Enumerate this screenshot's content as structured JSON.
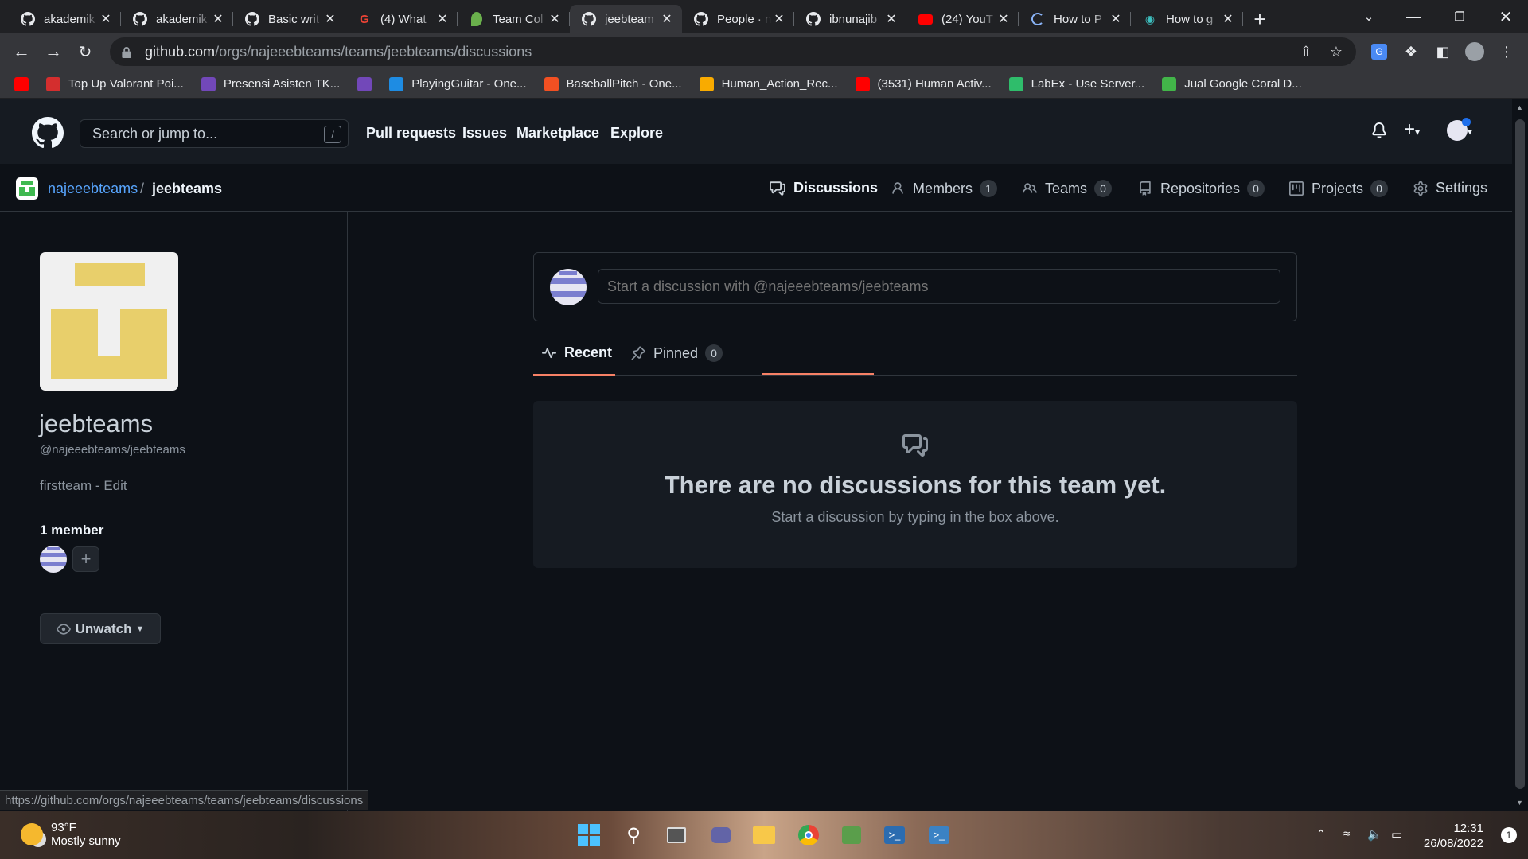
{
  "browser": {
    "tabs": [
      {
        "title": "akademik",
        "icon": "github-icon",
        "active": false
      },
      {
        "title": "akademik",
        "icon": "github-icon",
        "active": false
      },
      {
        "title": "Basic writ",
        "icon": "github-icon",
        "active": false
      },
      {
        "title": "(4) What",
        "icon": "google-icon",
        "active": false
      },
      {
        "title": "Team Col",
        "icon": "leaf-icon",
        "active": false
      },
      {
        "title": "jeebteam",
        "icon": "github-icon",
        "active": true
      },
      {
        "title": "People · n",
        "icon": "github-icon",
        "active": false
      },
      {
        "title": "ibnunajib",
        "icon": "github-icon",
        "active": false
      },
      {
        "title": "(24) YouT",
        "icon": "youtube-icon",
        "active": false
      },
      {
        "title": "How to P",
        "icon": "loading-icon",
        "active": false
      },
      {
        "title": "How to g",
        "icon": "eye-icon",
        "active": false
      }
    ],
    "url_host": "github.com",
    "url_path": "/orgs/najeeebteams/teams/jeebteams/discussions",
    "bookmarks": [
      {
        "label": "",
        "icon": "youtube-icon",
        "color": "#ff0000"
      },
      {
        "label": "Top Up Valorant Poi...",
        "icon": "codashop-icon",
        "color": "#d42e2e"
      },
      {
        "label": "Presensi Asisten TK...",
        "icon": "forms-icon",
        "color": "#7248b9"
      },
      {
        "label": "",
        "icon": "forms-icon",
        "color": "#7248b9"
      },
      {
        "label": "PlayingGuitar - One...",
        "icon": "onedrive-icon",
        "color": "#1e8ce3"
      },
      {
        "label": "BaseballPitch - One...",
        "icon": "windows-icon",
        "color": "#f25022"
      },
      {
        "label": "Human_Action_Rec...",
        "icon": "colab-icon",
        "color": "#f9ab00"
      },
      {
        "label": "(3531) Human Activ...",
        "icon": "youtube-icon",
        "color": "#ff0000"
      },
      {
        "label": "LabEx - Use Server...",
        "icon": "labex-icon",
        "color": "#2fbd6b"
      },
      {
        "label": "Jual Google Coral D...",
        "icon": "tokopedia-icon",
        "color": "#42b549"
      }
    ],
    "status_url": "https://github.com/orgs/najeeebteams/teams/jeebteams/discussions"
  },
  "github": {
    "search_placeholder": "Search or jump to...",
    "search_shortcut": "/",
    "nav": [
      "Pull requests",
      "Issues",
      "Marketplace",
      "Explore"
    ]
  },
  "team": {
    "org": "najeeebteams",
    "name": "jeebteams",
    "slug": "@najeeebteams/jeebteams",
    "description": "firstteam",
    "edit_label": "Edit",
    "members_heading": "1 member",
    "unwatch_label": "Unwatch",
    "tabs": [
      {
        "label": "Discussions",
        "count": null,
        "active": true
      },
      {
        "label": "Members",
        "count": "1"
      },
      {
        "label": "Teams",
        "count": "0"
      },
      {
        "label": "Repositories",
        "count": "0"
      },
      {
        "label": "Projects",
        "count": "0"
      },
      {
        "label": "Settings",
        "count": null
      }
    ]
  },
  "discussions": {
    "composer_placeholder": "Start a discussion with @najeeebteams/jeebteams",
    "tab_recent": "Recent",
    "tab_pinned": "Pinned",
    "pinned_count": "0",
    "empty_title": "There are no discussions for this team yet.",
    "empty_subtitle": "Start a discussion by typing in the box above."
  },
  "taskbar": {
    "temperature": "93°F",
    "weather": "Mostly sunny",
    "time": "12:31",
    "date": "26/08/2022",
    "notification_count": "1"
  },
  "colors": {
    "accent_underline": "#f78166",
    "team_avatar": "#e8cf6b",
    "bg": "#0d1117"
  }
}
